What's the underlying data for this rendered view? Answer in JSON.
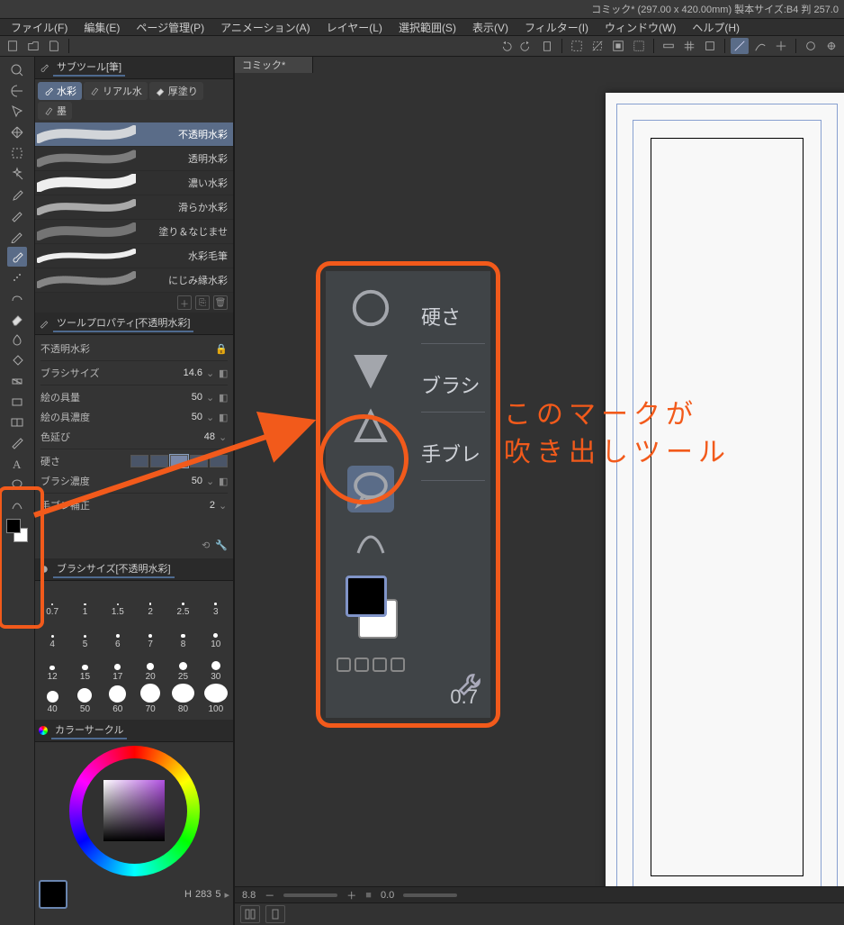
{
  "title": "コミック* (297.00 x 420.00mm) 製本サイズ:B4 判 257.0",
  "menu": [
    "ファイル(F)",
    "編集(E)",
    "ページ管理(P)",
    "アニメーション(A)",
    "レイヤー(L)",
    "選択範囲(S)",
    "表示(V)",
    "フィルター(I)",
    "ウィンドウ(W)",
    "ヘルプ(H)"
  ],
  "doc_tab": "コミック*",
  "subtool_title": "サブツール[筆]",
  "subtool_groups": [
    {
      "label": "水彩",
      "selected": true
    },
    {
      "label": "リアル水",
      "selected": false
    },
    {
      "label": "厚塗り",
      "selected": false
    },
    {
      "label": "墨",
      "selected": false
    }
  ],
  "brushes": [
    {
      "name": "不透明水彩",
      "selected": true
    },
    {
      "name": "透明水彩"
    },
    {
      "name": "濃い水彩"
    },
    {
      "name": "滑らか水彩"
    },
    {
      "name": "塗り＆なじませ"
    },
    {
      "name": "水彩毛筆"
    },
    {
      "name": "にじみ縁水彩"
    }
  ],
  "toolprop_title": "ツールプロパティ[不透明水彩]",
  "toolprop_name": "不透明水彩",
  "props": {
    "brush_size_label": "ブラシサイズ",
    "brush_size_val": "14.6",
    "paint_amt_label": "絵の具量",
    "paint_amt_val": "50",
    "paint_den_label": "絵の具濃度",
    "paint_den_val": "50",
    "color_ext_label": "色延び",
    "color_ext_val": "48",
    "hardness_label": "硬さ",
    "brush_den_label": "ブラシ濃度",
    "brush_den_val": "50",
    "stabilize_label": "手ブレ補正",
    "stabilize_val": "2"
  },
  "brush_size_panel_title": "ブラシサイズ[不透明水彩]",
  "brush_sizes": [
    "0.7",
    "1",
    "1.5",
    "2",
    "2.5",
    "3",
    "4",
    "5",
    "6",
    "7",
    "8",
    "10",
    "12",
    "15",
    "17",
    "20",
    "25",
    "30",
    "40",
    "50",
    "60",
    "70",
    "80",
    "100"
  ],
  "color_panel_title": "カラーサークル",
  "color_read": {
    "label": "H",
    "v1": "283",
    "v2": "5"
  },
  "statusbar": {
    "zoom": "8.8",
    "angle": "0.0"
  },
  "zoom_panel": {
    "r1": "硬さ",
    "r2": "ブラシ",
    "r3": "手ブレ",
    "bottom": "0.7"
  },
  "annotation": {
    "line1": "このマークが",
    "line2": "吹き出しツール"
  }
}
